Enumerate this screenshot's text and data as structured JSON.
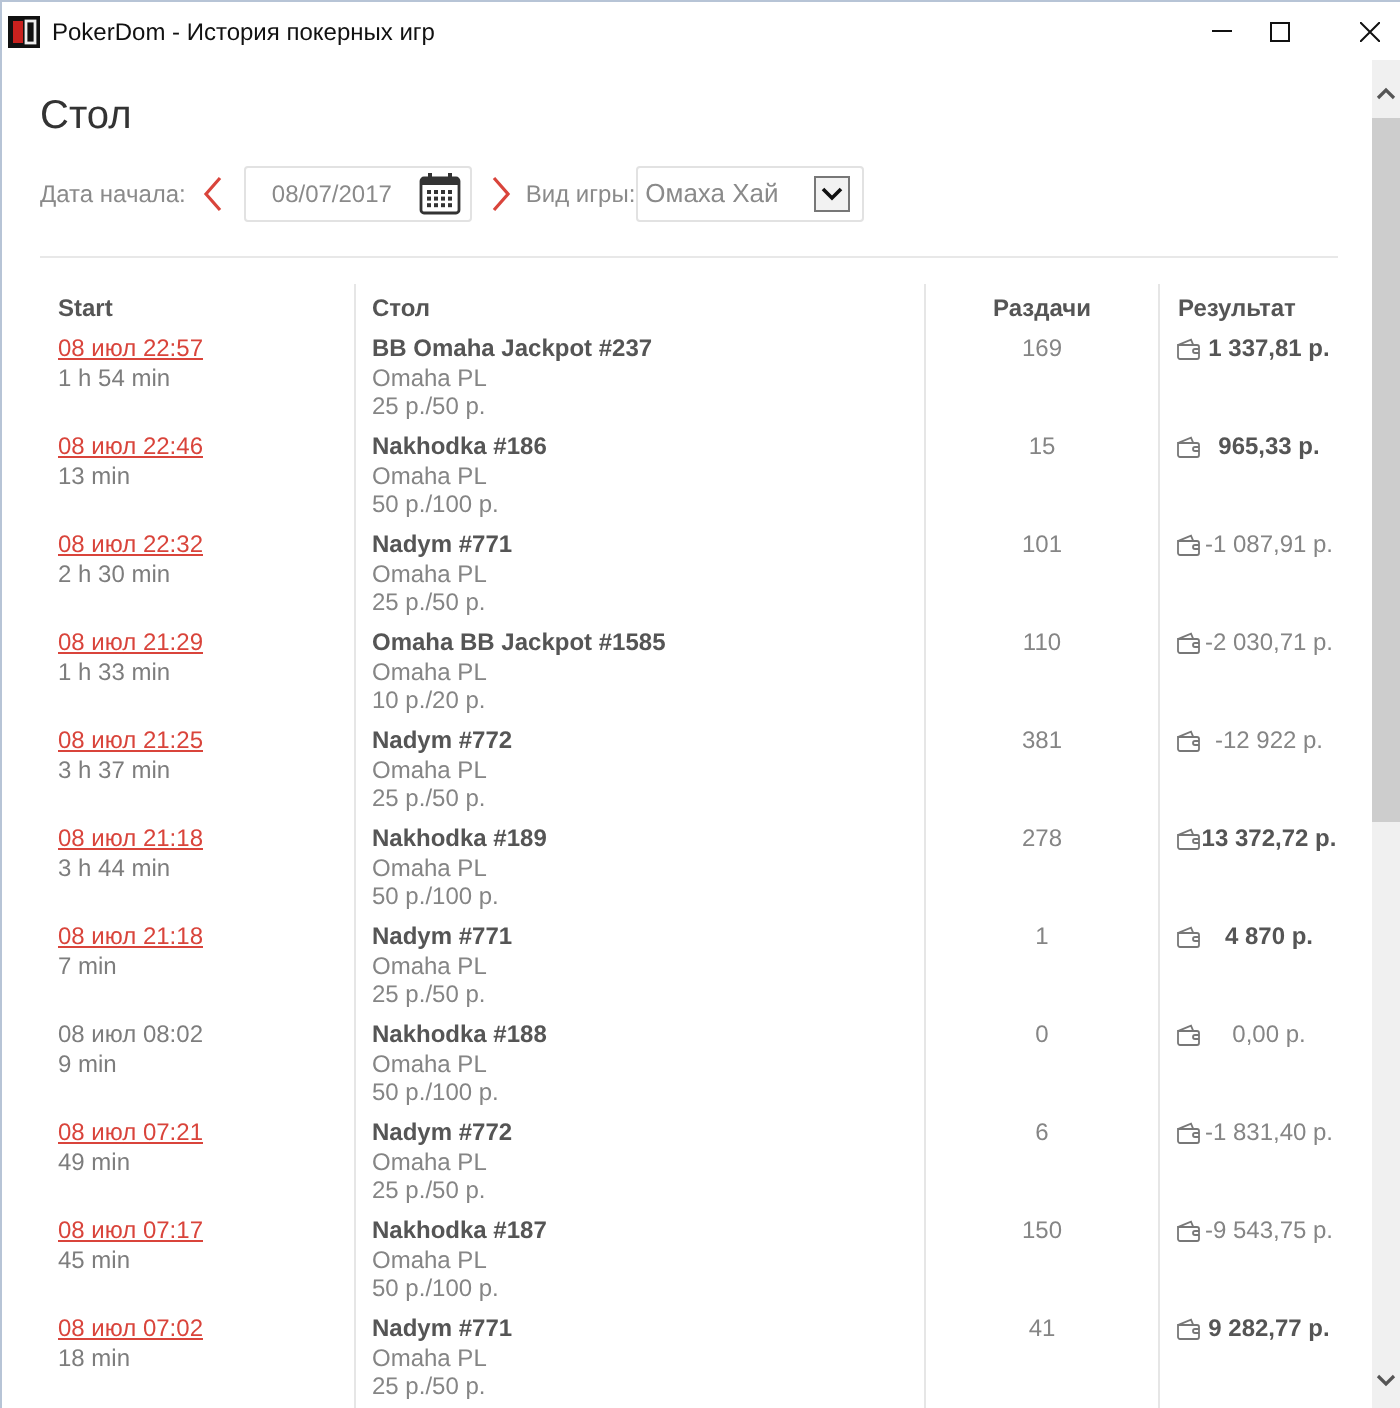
{
  "window": {
    "title": "PokerDom - История покерных игр"
  },
  "heading": "Стол",
  "filters": {
    "date_label": "Дата начала:",
    "date_value": "08/07/2017",
    "game_label": "Вид игры:",
    "game_value": "Омаха Хай"
  },
  "table": {
    "columns": [
      "Start",
      "Стол",
      "Раздачи",
      "Результат"
    ],
    "rows": [
      {
        "start": "08 июл 22:57",
        "linked": true,
        "duration": "1 h 54 min",
        "table": "BB Omaha Jackpot #237",
        "game": "Omaha PL",
        "stakes": "25 р./50 р.",
        "hands": "169",
        "result": "1 337,81 р.",
        "win": true
      },
      {
        "start": "08 июл 22:46",
        "linked": true,
        "duration": "13 min",
        "table": "Nakhodka #186",
        "game": "Omaha PL",
        "stakes": "50 р./100 р.",
        "hands": "15",
        "result": "965,33 р.",
        "win": true
      },
      {
        "start": "08 июл 22:32",
        "linked": true,
        "duration": "2 h 30 min",
        "table": "Nadym #771",
        "game": "Omaha PL",
        "stakes": "25 р./50 р.",
        "hands": "101",
        "result": "-1 087,91 р.",
        "win": false
      },
      {
        "start": "08 июл 21:29",
        "linked": true,
        "duration": "1 h 33 min",
        "table": "Omaha BB Jackpot #1585",
        "game": "Omaha PL",
        "stakes": "10 р./20 р.",
        "hands": "110",
        "result": "-2 030,71 р.",
        "win": false
      },
      {
        "start": "08 июл 21:25",
        "linked": true,
        "duration": "3 h 37 min",
        "table": "Nadym #772",
        "game": "Omaha PL",
        "stakes": "25 р./50 р.",
        "hands": "381",
        "result": "-12 922 р.",
        "win": false
      },
      {
        "start": "08 июл 21:18",
        "linked": true,
        "duration": "3 h 44 min",
        "table": "Nakhodka #189",
        "game": "Omaha PL",
        "stakes": "50 р./100 р.",
        "hands": "278",
        "result": "13 372,72 р.",
        "win": true
      },
      {
        "start": "08 июл 21:18",
        "linked": true,
        "duration": "7 min",
        "table": "Nadym #771",
        "game": "Omaha PL",
        "stakes": "25 р./50 р.",
        "hands": "1",
        "result": "4 870 р.",
        "win": true
      },
      {
        "start": "08 июл 08:02",
        "linked": false,
        "duration": "9 min",
        "table": "Nakhodka #188",
        "game": "Omaha PL",
        "stakes": "50 р./100 р.",
        "hands": "0",
        "result": "0,00 р.",
        "win": false
      },
      {
        "start": "08 июл 07:21",
        "linked": true,
        "duration": "49 min",
        "table": "Nadym #772",
        "game": "Omaha PL",
        "stakes": "25 р./50 р.",
        "hands": "6",
        "result": "-1 831,40 р.",
        "win": false
      },
      {
        "start": "08 июл 07:17",
        "linked": true,
        "duration": "45 min",
        "table": "Nakhodka #187",
        "game": "Omaha PL",
        "stakes": "50 р./100 р.",
        "hands": "150",
        "result": "-9 543,75 р.",
        "win": false
      },
      {
        "start": "08 июл 07:02",
        "linked": true,
        "duration": "18 min",
        "table": "Nadym #771",
        "game": "Omaha PL",
        "stakes": "25 р./50 р.",
        "hands": "41",
        "result": "9 282,77 р.",
        "win": true
      }
    ]
  }
}
